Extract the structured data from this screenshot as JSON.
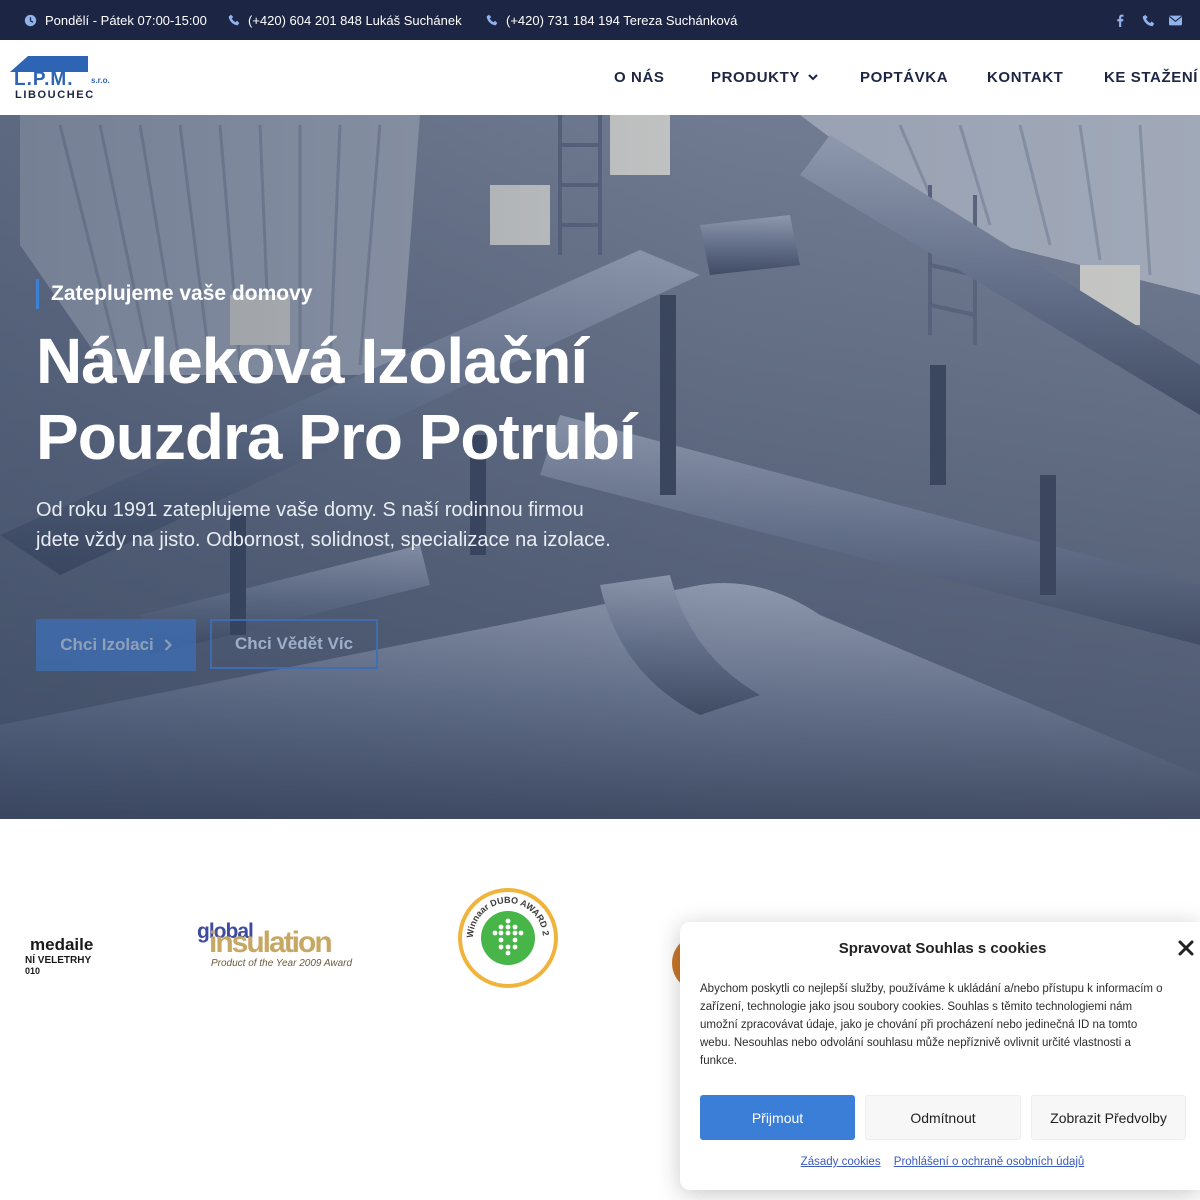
{
  "topbar": {
    "hours": "Pondělí - Pátek 07:00-15:00",
    "phone1": "(+420) 604 201 848 Lukáš Suchánek",
    "phone2": "(+420) 731 184 194 Tereza Suchánková",
    "icons": [
      "clock-icon",
      "phone-icon",
      "phone-icon",
      "facebook-icon",
      "phone-icon",
      "email-icon"
    ]
  },
  "header": {
    "logo_main": "L.P.M.",
    "logo_suffix": "s.r.o.",
    "logo_city": "LIBOUCHEC",
    "nav": [
      "O NÁS",
      "PRODUKTY",
      "POPTÁVKA",
      "KONTAKT",
      "KE STAŽENÍ"
    ]
  },
  "hero": {
    "tagline": "Zateplujeme vaše domovy",
    "title_line1": "Návleková Izolační",
    "title_line2": "Pouzdra Pro Potrubí",
    "text": "Od roku 1991 zateplujeme vaše domy. S naší rodinnou firmou jdete vždy na jisto. Odbornost, solidnost, specializace na izolace.",
    "btn_primary": "Chci Izolaci",
    "btn_secondary": "Chci Vědět Víc"
  },
  "awards": {
    "medaile_line1": "medaile",
    "medaile_line2": "NÍ VELETRHY",
    "medaile_line3": "010",
    "global_line1": "global",
    "global_line2": "insulation",
    "global_line3": "Product of the Year 2009 Award",
    "dubo_text": "Winnaar DUBO AWARD 2009"
  },
  "cookie": {
    "title": "Spravovat Souhlas s cookies",
    "text": "Abychom poskytli co nejlepší služby, používáme k ukládání a/nebo přístupu k informacím o zařízení, technologie jako jsou soubory cookies. Souhlas s těmito technologiemi nám umožní zpracovávat údaje, jako je chování při procházení nebo jedinečná ID na tomto webu. Nesouhlas nebo odvolání souhlasu může nepříznivě ovlivnit určité vlastnosti a funkce.",
    "accept": "Přijmout",
    "deny": "Odmítnout",
    "prefs": "Zobrazit Předvolby",
    "link_policy": "Zásady cookies",
    "link_privacy": "Prohlášení o ochraně osobních údajů"
  },
  "colors": {
    "topbar": "#1c2543",
    "accent": "#3b7ed8",
    "nav_text": "#1c2543"
  }
}
